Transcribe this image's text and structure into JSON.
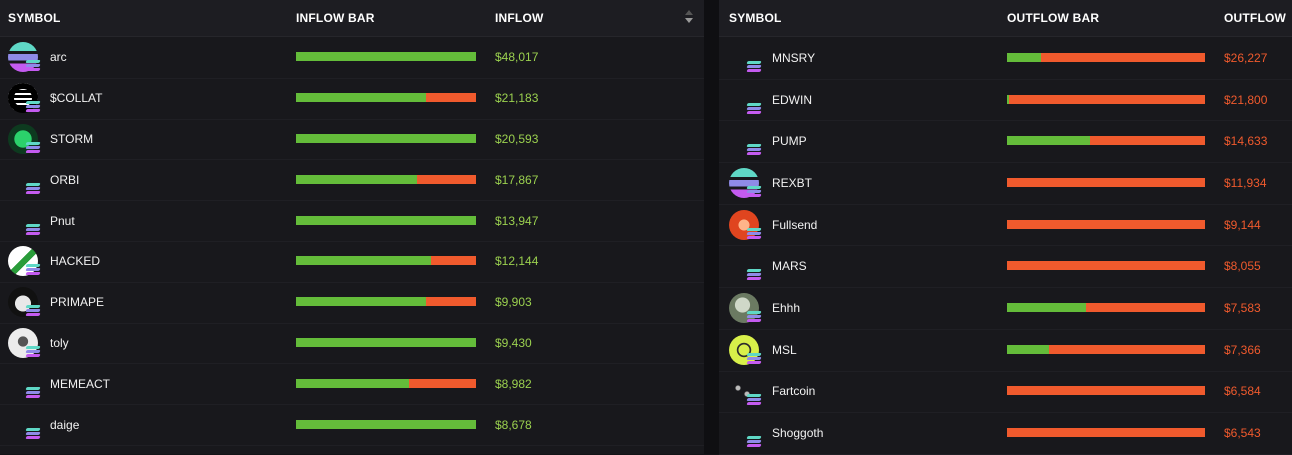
{
  "inflow": {
    "headers": {
      "symbol": "SYMBOL",
      "bar": "INFLOW BAR",
      "value": "INFLOW"
    },
    "rows": [
      {
        "symbol": "arc",
        "value": "$48,017",
        "green_fraction": 1.0,
        "icon": "arc-logo-icon"
      },
      {
        "symbol": "$COLLAT",
        "value": "$21,183",
        "green_fraction": 0.72,
        "icon": "collat-logo-icon"
      },
      {
        "symbol": "STORM",
        "value": "$20,593",
        "green_fraction": 1.0,
        "icon": "storm-logo-icon"
      },
      {
        "symbol": "ORBI",
        "value": "$17,867",
        "green_fraction": 0.67,
        "icon": ""
      },
      {
        "symbol": "Pnut",
        "value": "$13,947",
        "green_fraction": 1.0,
        "icon": ""
      },
      {
        "symbol": "HACKED",
        "value": "$12,144",
        "green_fraction": 0.75,
        "icon": "pill-logo-icon"
      },
      {
        "symbol": "PRIMAPE",
        "value": "$9,903",
        "green_fraction": 0.72,
        "icon": "ape-logo-icon"
      },
      {
        "symbol": "toly",
        "value": "$9,430",
        "green_fraction": 1.0,
        "icon": "toly-logo-icon"
      },
      {
        "symbol": "MEMEACT",
        "value": "$8,982",
        "green_fraction": 0.63,
        "icon": ""
      },
      {
        "symbol": "daige",
        "value": "$8,678",
        "green_fraction": 1.0,
        "icon": ""
      }
    ]
  },
  "outflow": {
    "headers": {
      "symbol": "SYMBOL",
      "bar": "OUTFLOW BAR",
      "value": "OUTFLOW"
    },
    "rows": [
      {
        "symbol": "MNSRY",
        "value": "$26,227",
        "green_fraction": 0.17,
        "icon": ""
      },
      {
        "symbol": "EDWIN",
        "value": "$21,800",
        "green_fraction": 0.01,
        "icon": ""
      },
      {
        "symbol": "PUMP",
        "value": "$14,633",
        "green_fraction": 0.42,
        "icon": ""
      },
      {
        "symbol": "REXBT",
        "value": "$11,934",
        "green_fraction": 0.0,
        "icon": "rexbt-logo-icon"
      },
      {
        "symbol": "Fullsend",
        "value": "$9,144",
        "green_fraction": 0.0,
        "icon": "fullsend-logo-icon"
      },
      {
        "symbol": "MARS",
        "value": "$8,055",
        "green_fraction": 0.0,
        "icon": ""
      },
      {
        "symbol": "Ehhh",
        "value": "$7,583",
        "green_fraction": 0.4,
        "icon": "ehhh-logo-icon"
      },
      {
        "symbol": "MSL",
        "value": "$7,366",
        "green_fraction": 0.21,
        "icon": "msl-logo-icon"
      },
      {
        "symbol": "Fartcoin",
        "value": "$6,584",
        "green_fraction": 0.0,
        "icon": "fartcoin-logo-icon"
      },
      {
        "symbol": "Shoggoth",
        "value": "$6,543",
        "green_fraction": 0.0,
        "icon": ""
      }
    ]
  },
  "colors": {
    "green": "#64bc3a",
    "red": "#f05a2d",
    "inflow_text": "#9bd14f",
    "outflow_text": "#f05a2d"
  }
}
